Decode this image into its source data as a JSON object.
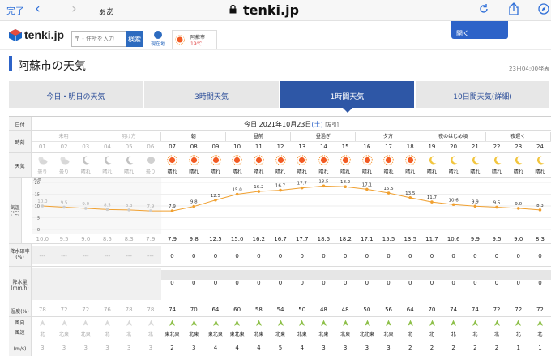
{
  "browser": {
    "done": "完了",
    "back": "‹",
    "forward": "›",
    "aa": "ぁあ",
    "url": "tenki.jp"
  },
  "site": {
    "logo": "tenki.jp",
    "search_placeholder": "〒・住所を入力",
    "search_button": "検索",
    "location_button": "現在地",
    "mini_city": "阿蘇市",
    "mini_temp": "19℃",
    "popup": "開く"
  },
  "page": {
    "title": "阿蘇市の天気",
    "time": "23日04:00発表"
  },
  "tabs": [
    "今日・明日の天気",
    "3時間天気",
    "1時間天気",
    "10日間天気(詳細)"
  ],
  "tabs_active": 2,
  "table": {
    "date_label": "日付",
    "date": "今日 2021年10月23日",
    "date_day": "(土)",
    "date_tag": "[友引]",
    "time_label": "時刻",
    "weather_label": "天気",
    "temp_label": "気温",
    "temp_unit": "(℃)",
    "precip_prob_label": "降水確率",
    "precip_prob_unit": "(%)",
    "precip_label": "降水量",
    "precip_unit": "(mm/h)",
    "humidity_label": "湿度(%)",
    "wind_dir_label": "風向",
    "wind_speed_label": "風速",
    "wind_unit": "(m/s)",
    "y_ticks": [
      "20",
      "15",
      "10",
      "5",
      "0"
    ],
    "y_top": "気温",
    "periods": [
      {
        "label": "未明",
        "span": 3,
        "past": true
      },
      {
        "label": "明け方",
        "span": 3,
        "past": true
      },
      {
        "label": "朝",
        "span": 3
      },
      {
        "label": "昼前",
        "span": 3
      },
      {
        "label": "昼過ぎ",
        "span": 3
      },
      {
        "label": "夕方",
        "span": 3
      },
      {
        "label": "夜のはじめ頃",
        "span": 3
      },
      {
        "label": "夜遅く",
        "span": 3
      }
    ],
    "hours": [
      "01",
      "02",
      "03",
      "04",
      "05",
      "06",
      "07",
      "08",
      "09",
      "10",
      "11",
      "12",
      "13",
      "14",
      "15",
      "16",
      "17",
      "18",
      "19",
      "20",
      "21",
      "22",
      "23",
      "24"
    ],
    "weather": [
      "曇り",
      "曇り",
      "晴れ",
      "晴れ",
      "晴れ",
      "曇り",
      "晴れ",
      "晴れ",
      "晴れ",
      "晴れ",
      "晴れ",
      "晴れ",
      "晴れ",
      "晴れ",
      "晴れ",
      "晴れ",
      "晴れ",
      "晴れ",
      "晴れ",
      "晴れ",
      "晴れ",
      "晴れ",
      "晴れ",
      "晴れ"
    ],
    "weather_icons": [
      "cloud-sun-icon",
      "cloud-moon-icon",
      "moon-icon",
      "moon-icon",
      "moon-icon",
      "cloud-icon",
      "sun-icon",
      "sun-icon",
      "sun-icon",
      "sun-icon",
      "sun-icon",
      "sun-icon",
      "sun-icon",
      "sun-icon",
      "sun-icon",
      "sun-icon",
      "sun-icon",
      "sun-icon",
      "moon-icon",
      "moon-icon",
      "moon-icon",
      "moon-icon",
      "moon-icon",
      "moon-icon"
    ],
    "temps": [
      "10.0",
      "9.5",
      "9.0",
      "8.5",
      "8.3",
      "7.9",
      "7.9",
      "9.8",
      "12.5",
      "15.0",
      "16.2",
      "16.7",
      "17.7",
      "18.5",
      "18.2",
      "17.1",
      "15.5",
      "13.5",
      "11.7",
      "10.6",
      "9.9",
      "9.5",
      "9.0",
      "8.3"
    ],
    "precip_prob": [
      "---",
      "---",
      "---",
      "---",
      "---",
      "---",
      "0",
      "0",
      "0",
      "0",
      "0",
      "0",
      "0",
      "0",
      "0",
      "0",
      "0",
      "0",
      "0",
      "0",
      "0",
      "0",
      "0",
      "0"
    ],
    "precip": [
      "",
      "",
      "",
      "",
      "",
      "",
      "0",
      "0",
      "0",
      "0",
      "0",
      "0",
      "0",
      "0",
      "0",
      "0",
      "0",
      "0",
      "0",
      "0",
      "0",
      "0",
      "0",
      "0"
    ],
    "humidity": [
      "78",
      "72",
      "72",
      "76",
      "78",
      "78",
      "74",
      "70",
      "64",
      "60",
      "58",
      "54",
      "50",
      "48",
      "48",
      "50",
      "56",
      "64",
      "70",
      "74",
      "74",
      "72",
      "72",
      "72"
    ],
    "wind_dir": [
      "北",
      "北東",
      "北東",
      "北",
      "北",
      "北",
      "東北東",
      "北東",
      "東北東",
      "東北東",
      "北東",
      "北東",
      "北東",
      "北東",
      "北東",
      "北北東",
      "北東",
      "北",
      "北",
      "北",
      "北",
      "北",
      "北",
      "北"
    ],
    "wind_speed": [
      "3",
      "3",
      "3",
      "3",
      "3",
      "3",
      "2",
      "3",
      "4",
      "4",
      "4",
      "5",
      "4",
      "3",
      "3",
      "3",
      "3",
      "2",
      "2",
      "2",
      "2",
      "2",
      "1",
      "1"
    ]
  },
  "chart_data": {
    "type": "line",
    "x": [
      "01",
      "02",
      "03",
      "04",
      "05",
      "06",
      "07",
      "08",
      "09",
      "10",
      "11",
      "12",
      "13",
      "14",
      "15",
      "16",
      "17",
      "18",
      "19",
      "20",
      "21",
      "22",
      "23",
      "24"
    ],
    "values": [
      10.0,
      9.5,
      9.0,
      8.5,
      8.3,
      7.9,
      7.9,
      9.8,
      12.5,
      15.0,
      16.2,
      16.7,
      17.7,
      18.5,
      18.2,
      17.1,
      15.5,
      13.5,
      11.7,
      10.6,
      9.9,
      9.5,
      9.0,
      8.3
    ],
    "ylabel": "気温",
    "ylim": [
      0,
      20
    ],
    "color": "#f0a030"
  }
}
